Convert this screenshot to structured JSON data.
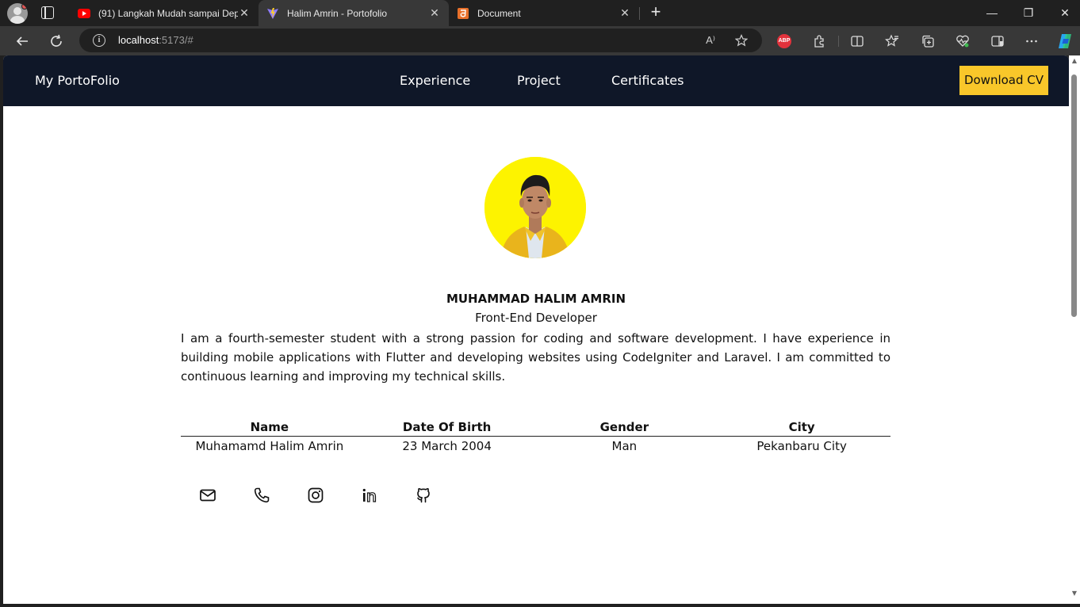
{
  "browser": {
    "tabs": [
      {
        "title": "(91) Langkah Mudah sampai Dep",
        "icon": "youtube-icon"
      },
      {
        "title": "Halim Amrin - Portofolio",
        "icon": "vite-icon"
      },
      {
        "title": "Document",
        "icon": "html5-icon"
      }
    ],
    "url_host": "localhost",
    "url_rest": ":5173/#",
    "extensions": [
      "adblock-plus-icon",
      "extensions-icon",
      "split-screen-icon",
      "favorites-icon",
      "collections-icon",
      "browser-essentials-icon",
      "sidebar-icon",
      "more-icon",
      "copilot-icon"
    ],
    "abp_label": "ABP",
    "read_aloud_label": "A⁾"
  },
  "site": {
    "brand": "My PortoFolio",
    "nav": [
      "Experience",
      "Project",
      "Certificates"
    ],
    "cv_button": "Download CV",
    "accent_color": "#f9c72a",
    "nav_color": "#0f1728"
  },
  "profile": {
    "name": "MUHAMMAD HALIM AMRIN",
    "role": "Front-End Developer",
    "bio": "I am a fourth-semester student with a strong passion for coding and software development. I have experience in building mobile applications with Flutter and developing websites using CodeIgniter and Laravel. I am committed to continuous learning and improving my technical skills."
  },
  "table": {
    "headers": [
      "Name",
      "Date Of Birth",
      "Gender",
      "City"
    ],
    "row": [
      "Muhamamd Halim Amrin",
      "23 March 2004",
      "Man",
      "Pekanbaru City"
    ]
  },
  "socials": [
    "mail-icon",
    "phone-icon",
    "instagram-icon",
    "linkedin-icon",
    "github-icon"
  ]
}
